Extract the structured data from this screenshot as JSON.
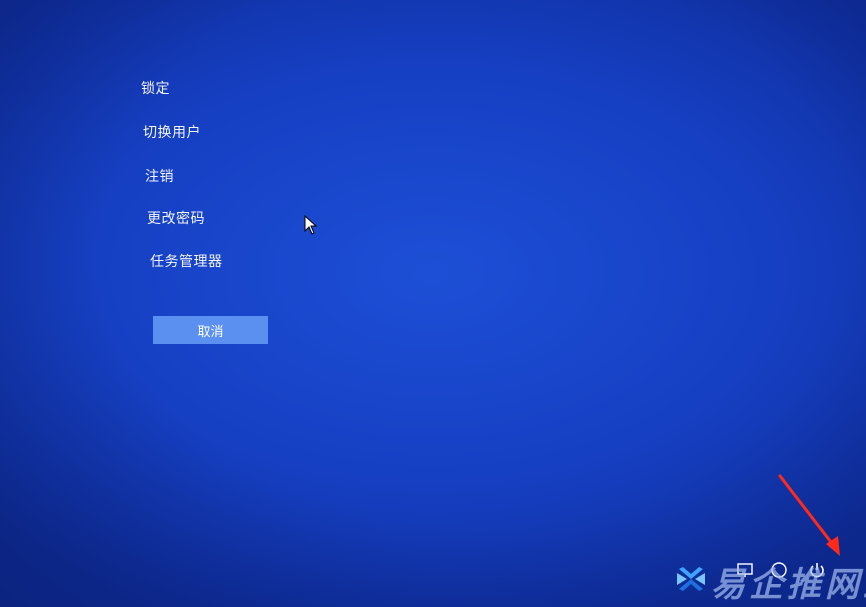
{
  "menu": {
    "items": [
      {
        "label": "锁定"
      },
      {
        "label": "切换用户"
      },
      {
        "label": "注销"
      },
      {
        "label": "更改密码"
      },
      {
        "label": "任务管理器"
      }
    ]
  },
  "cancel": {
    "label": "取消"
  },
  "watermark": {
    "text": "易企推网络"
  },
  "colors": {
    "background": "#1640c4",
    "button": "#5b8ff0",
    "arrow": "#ff2a1a"
  }
}
